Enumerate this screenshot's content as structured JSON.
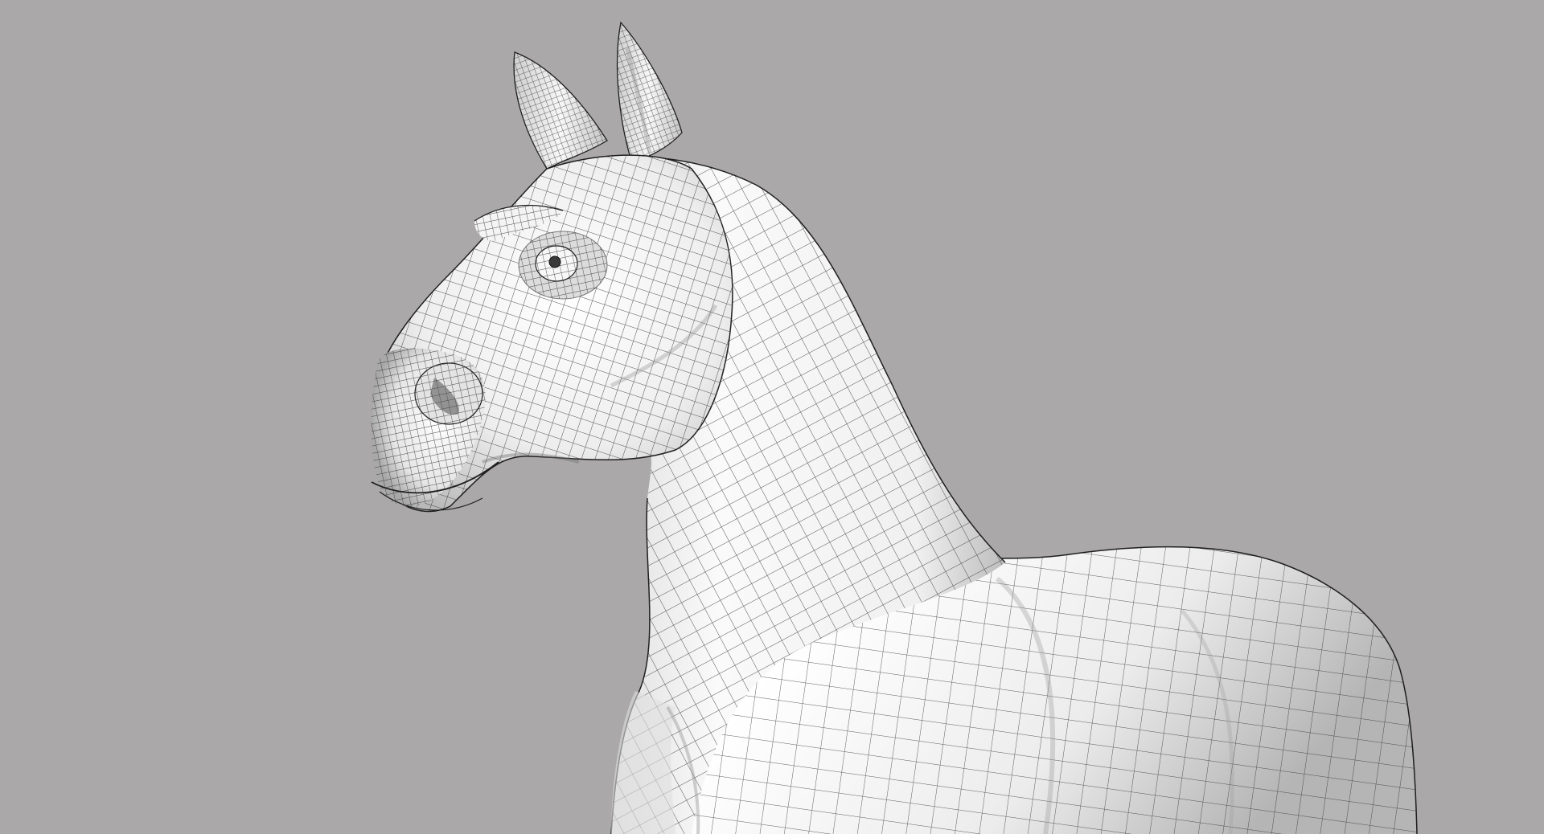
{
  "scene": {
    "background_color": "#aaa8a9",
    "model_base_color": "#f2f2f2",
    "model_shadow_color": "#b9b9b9",
    "wire_color": "#2b2b2b",
    "subject": "horse-wireframe-model"
  }
}
